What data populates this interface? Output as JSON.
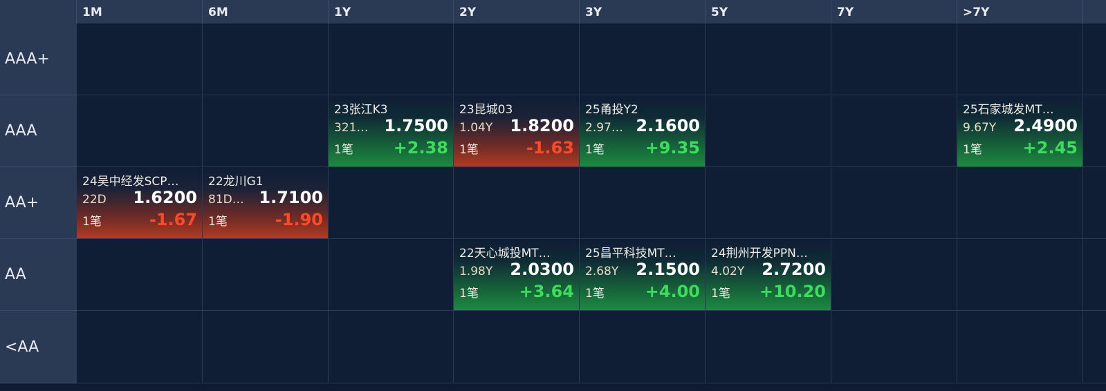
{
  "columns": [
    "1M",
    "6M",
    "1Y",
    "2Y",
    "3Y",
    "5Y",
    "7Y",
    ">7Y"
  ],
  "rows": [
    "AAA+",
    "AAA",
    "AA+",
    "AA",
    "<AA"
  ],
  "colors": {
    "negative": "#ff4a2a",
    "positive": "#3ddc5a",
    "header_bg": "#2a3a54",
    "cell_bg": "#0f1d35"
  },
  "cells": {
    "AAA": {
      "1Y": {
        "name": "23张江K3",
        "term": "321…",
        "yield": "1.7500",
        "count": "1笔",
        "change": "+2.38",
        "dir": "pos"
      },
      "2Y": {
        "name": "23昆城03",
        "term": "1.04Y",
        "yield": "1.8200",
        "count": "1笔",
        "change": "-1.63",
        "dir": "neg"
      },
      "3Y": {
        "name": "25甬投Y2",
        "term": "2.97…",
        "yield": "2.1600",
        "count": "1笔",
        "change": "+9.35",
        "dir": "pos"
      },
      ">7Y": {
        "name": "25石家城发MT…",
        "term": "9.67Y",
        "yield": "2.4900",
        "count": "1笔",
        "change": "+2.45",
        "dir": "pos"
      }
    },
    "AA+": {
      "1M": {
        "name": "24吴中经发SCP…",
        "term": "22D",
        "yield": "1.6200",
        "count": "1笔",
        "change": "-1.67",
        "dir": "neg"
      },
      "6M": {
        "name": "22龙川G1",
        "term": "81D…",
        "yield": "1.7100",
        "count": "1笔",
        "change": "-1.90",
        "dir": "neg"
      }
    },
    "AA": {
      "2Y": {
        "name": "22天心城投MT…",
        "term": "1.98Y",
        "yield": "2.0300",
        "count": "1笔",
        "change": "+3.64",
        "dir": "pos"
      },
      "3Y": {
        "name": "25昌平科技MT…",
        "term": "2.68Y",
        "yield": "2.1500",
        "count": "1笔",
        "change": "+4.00",
        "dir": "pos"
      },
      "5Y": {
        "name": "24荆州开发PPN…",
        "term": "4.02Y",
        "yield": "2.7200",
        "count": "1笔",
        "change": "+10.20",
        "dir": "pos"
      }
    }
  }
}
